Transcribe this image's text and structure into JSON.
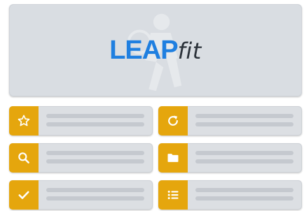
{
  "brand": {
    "logo_bold": "LEAP",
    "logo_light": "fit",
    "logo_color": "#1f7fe0",
    "logo_light_color": "#2c323a"
  },
  "accent_color": "#e5a60d",
  "tiles": [
    {
      "icon": "star-icon"
    },
    {
      "icon": "refresh-icon"
    },
    {
      "icon": "search-icon"
    },
    {
      "icon": "folder-icon"
    },
    {
      "icon": "checkmark-icon"
    },
    {
      "icon": "list-icon"
    }
  ]
}
